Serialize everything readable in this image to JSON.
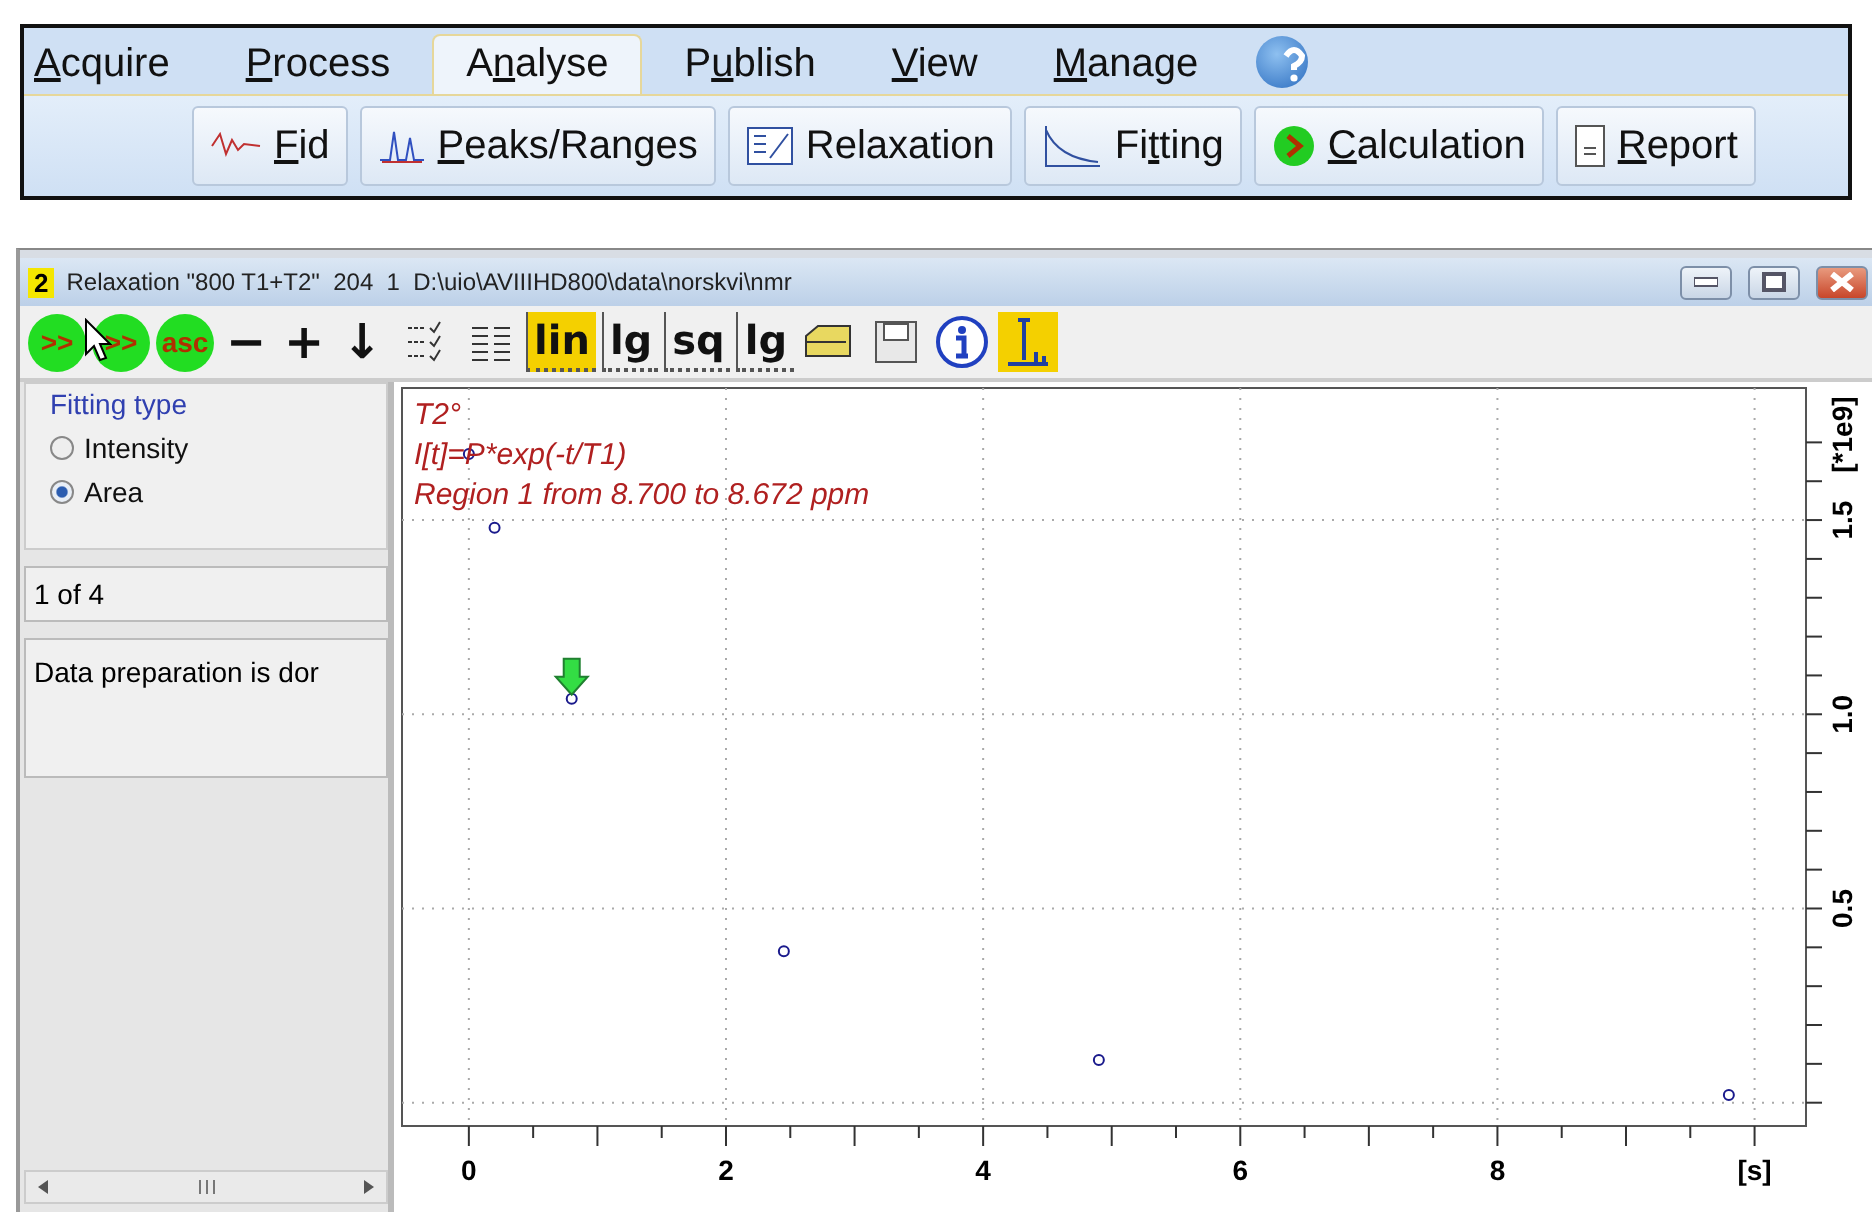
{
  "menu": [
    {
      "key": "A",
      "post": "cquire",
      "selected": false
    },
    {
      "key": "P",
      "post": "rocess",
      "selected": false
    },
    {
      "pre": "A",
      "key": "n",
      "post": "alyse",
      "selected": true
    },
    {
      "pre": "P",
      "key": "u",
      "post": "blish",
      "selected": false
    },
    {
      "key": "V",
      "post": "iew",
      "selected": false
    },
    {
      "key": "M",
      "post": "anage",
      "selected": false
    }
  ],
  "ribbon": [
    {
      "kind": "fid",
      "key": "F",
      "post": "id"
    },
    {
      "kind": "peaks",
      "key": "P",
      "post": "eaks/Ranges"
    },
    {
      "kind": "relaxation",
      "pre": "Relaxation"
    },
    {
      "kind": "fitting",
      "pre": "Fi",
      "key": "t",
      "post": "ting"
    },
    {
      "kind": "calculation",
      "key": "C",
      "post": "alculation"
    },
    {
      "kind": "report",
      "key": "R",
      "post": "eport"
    }
  ],
  "window": {
    "number": "2",
    "title": "Relaxation \"800 T1+T2\"  204  1  D:\\uio\\AVIIIHD800\\data\\norskvi\\nmr"
  },
  "toolbar": [
    {
      "kind": "round",
      "label": ">>"
    },
    {
      "kind": "round",
      "label": ">>"
    },
    {
      "kind": "round",
      "label": "asc"
    },
    {
      "kind": "glyph",
      "label": "−"
    },
    {
      "kind": "glyph",
      "label": "+"
    },
    {
      "kind": "glyph",
      "label": "↓"
    },
    {
      "kind": "checklist"
    },
    {
      "kind": "columns"
    },
    {
      "kind": "scale",
      "label": "lin",
      "selected": true
    },
    {
      "kind": "scale",
      "label": "lg",
      "selected": false
    },
    {
      "kind": "scale",
      "label": "sq",
      "selected": false
    },
    {
      "kind": "scale",
      "label": "lg",
      "selected": false
    },
    {
      "kind": "folder"
    },
    {
      "kind": "save"
    },
    {
      "kind": "info"
    },
    {
      "kind": "peak",
      "selected": true
    }
  ],
  "fitting": {
    "title": "Fitting type",
    "options": [
      {
        "label": "Intensity",
        "selected": false
      },
      {
        "label": "Area",
        "selected": true
      }
    ],
    "counter": "1 of 4",
    "message": "Data preparation is dor"
  },
  "plot": {
    "chart_data": {
      "type": "scatter",
      "grid": true,
      "xlabel": "[s]",
      "ylabel": "[*1e9]",
      "xlim": [
        -0.52,
        10.4
      ],
      "ylim": [
        -0.06,
        1.84
      ],
      "xticks": [
        0,
        2,
        4,
        6,
        8
      ],
      "yticks": [
        {
          "value": 0.5,
          "label": "0.5"
        },
        {
          "value": 1,
          "label": "1.0"
        },
        {
          "value": 1.5,
          "label": "1.5"
        }
      ],
      "x": [
        0,
        0.2,
        0.8,
        2.45,
        4.9,
        9.8
      ],
      "series": [
        {
          "color": "#1a1a8c",
          "values": [
            1.67,
            1.48,
            1.04,
            0.39,
            0.11,
            0.02
          ]
        }
      ],
      "annotations": [
        "T2°",
        "I[t]=P*exp(-t/T1)",
        "Region 1 from 8.700 to 8.672 ppm"
      ]
    }
  }
}
